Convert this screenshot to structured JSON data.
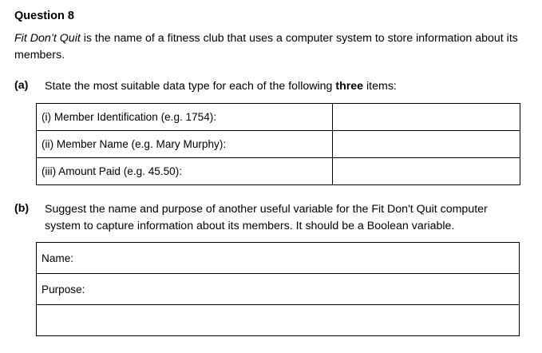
{
  "question": {
    "title": "Question 8",
    "intro_italic": "Fit Don’t Quit",
    "intro_rest": " is the name of a fitness club that uses a computer system to store information about its members."
  },
  "part_a": {
    "label": "(a)",
    "text_before": "State the most suitable data type for each of the following ",
    "text_bold": "three",
    "text_after": " items:",
    "rows": [
      {
        "label": "(i)  Member Identification (e.g. 1754):",
        "answer": ""
      },
      {
        "label": "(ii)  Member Name (e.g. Mary Murphy):",
        "answer": ""
      },
      {
        "label": "(iii) Amount Paid (e.g. 45.50):",
        "answer": ""
      }
    ]
  },
  "part_b": {
    "label": "(b)",
    "text": "Suggest the name and purpose of another useful variable for the Fit Don't Quit computer system to capture information about its members. It should be a Boolean variable.",
    "name_label": "Name:",
    "purpose_label": "Purpose:",
    "extra_line": ""
  }
}
